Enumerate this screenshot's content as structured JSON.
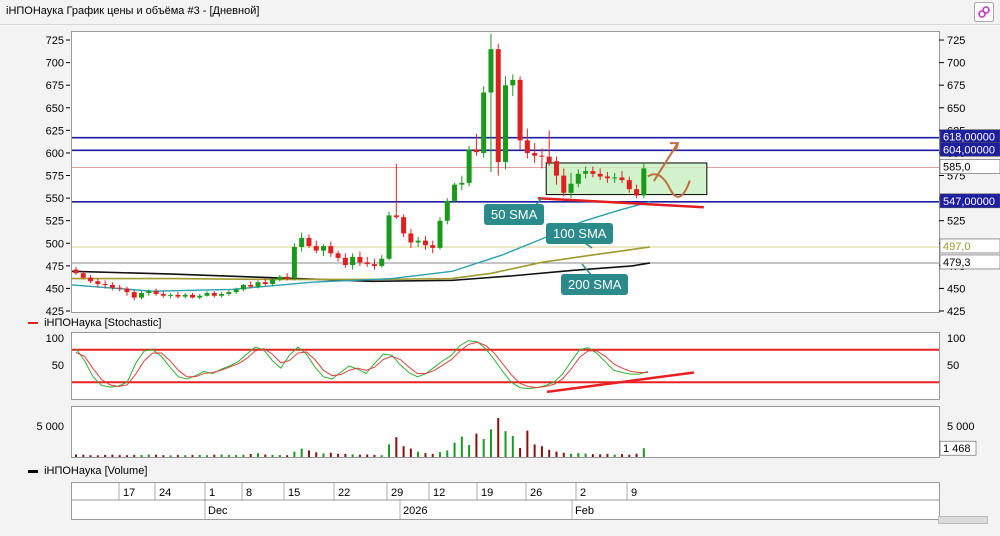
{
  "window": {
    "title": "iНПОНаука График цены и объёма #3 - [Дневной]"
  },
  "price_pane": {
    "y_ticks": [
      "725",
      "700",
      "675",
      "650",
      "625",
      "600",
      "575",
      "550",
      "525",
      "500",
      "475",
      "450",
      "425"
    ],
    "tags": {
      "level_618": "618,00000",
      "level_604": "604,00000",
      "last_price": "585,0",
      "level_547": "547,00000",
      "sma100_value": "497,0",
      "sma200_value": "479,3"
    },
    "callouts": {
      "sma50": "50 SMA",
      "sma100": "100 SMA",
      "sma200": "200 SMA"
    }
  },
  "stochastic_pane": {
    "legend": "iНПОНаука [Stochastic]",
    "y_ticks": [
      "100",
      "50"
    ]
  },
  "volume_pane": {
    "legend": "iНПОНаука [Volume]",
    "y_ticks": [
      "5 000"
    ],
    "last_value_tag": "1 468"
  },
  "x_axis": {
    "day_labels": [
      "17",
      "24",
      "1",
      "8",
      "15",
      "22",
      "29",
      "12",
      "19",
      "26",
      "2",
      "9"
    ],
    "month_labels": [
      "Dec",
      "2026",
      "Feb"
    ]
  },
  "colors": {
    "up_candle": "#1a9a1a",
    "down_candle": "#e02020",
    "horizontal_levels": "#1e1ea0",
    "sma50": "#2aa0b0",
    "sma100": "#a09a30",
    "sma200": "#111111",
    "callout_bg": "#2b8a8a",
    "stoch_bands": "#e82020"
  },
  "chart_data": [
    {
      "type": "candlestick",
      "title": "",
      "ylim": [
        425,
        735
      ],
      "horizontal_levels": [
        618,
        604,
        585,
        547,
        497,
        479.3
      ],
      "candles": [
        [
          472,
          475,
          466,
          468
        ],
        [
          468,
          470,
          461,
          463
        ],
        [
          463,
          466,
          457,
          459
        ],
        [
          459,
          462,
          452,
          456
        ],
        [
          456,
          460,
          451,
          455
        ],
        [
          455,
          458,
          449,
          452
        ],
        [
          452,
          455,
          448,
          451
        ],
        [
          451,
          453,
          443,
          447
        ],
        [
          447,
          449,
          438,
          441
        ],
        [
          441,
          448,
          439,
          446
        ],
        [
          446,
          450,
          443,
          448
        ],
        [
          448,
          451,
          443,
          445
        ],
        [
          445,
          448,
          441,
          443
        ],
        [
          443,
          446,
          440,
          444
        ],
        [
          444,
          447,
          440,
          442
        ],
        [
          442,
          446,
          440,
          444
        ],
        [
          444,
          446,
          440,
          441
        ],
        [
          441,
          445,
          439,
          443
        ],
        [
          443,
          448,
          442,
          446
        ],
        [
          446,
          448,
          441,
          443
        ],
        [
          443,
          447,
          441,
          445
        ],
        [
          445,
          449,
          443,
          447
        ],
        [
          447,
          452,
          445,
          450
        ],
        [
          450,
          456,
          448,
          455
        ],
        [
          455,
          459,
          451,
          453
        ],
        [
          453,
          460,
          451,
          458
        ],
        [
          458,
          462,
          454,
          456
        ],
        [
          456,
          462,
          454,
          461
        ],
        [
          461,
          466,
          459,
          464
        ],
        [
          464,
          468,
          460,
          462
        ],
        [
          463,
          501,
          460,
          497
        ],
        [
          497,
          513,
          492,
          507
        ],
        [
          507,
          511,
          496,
          498
        ],
        [
          498,
          504,
          490,
          493
        ],
        [
          493,
          500,
          487,
          498
        ],
        [
          498,
          503,
          486,
          490
        ],
        [
          490,
          493,
          481,
          485
        ],
        [
          485,
          490,
          474,
          477
        ],
        [
          477,
          490,
          472,
          486
        ],
        [
          486,
          492,
          476,
          480
        ],
        [
          480,
          486,
          475,
          478
        ],
        [
          478,
          484,
          472,
          476
        ],
        [
          476,
          488,
          474,
          484
        ],
        [
          484,
          536,
          482,
          532
        ],
        [
          532,
          589,
          528,
          530
        ],
        [
          530,
          533,
          508,
          512
        ],
        [
          512,
          517,
          496,
          502
        ],
        [
          502,
          508,
          497,
          504
        ],
        [
          504,
          509,
          494,
          499
        ],
        [
          499,
          504,
          490,
          496
        ],
        [
          496,
          530,
          494,
          526
        ],
        [
          526,
          551,
          522,
          548
        ],
        [
          548,
          568,
          546,
          566
        ],
        [
          566,
          576,
          560,
          568
        ],
        [
          568,
          609,
          564,
          605
        ],
        [
          605,
          622,
          598,
          602
        ],
        [
          601,
          675,
          596,
          668
        ],
        [
          668,
          733,
          580,
          716
        ],
        [
          716,
          722,
          576,
          591
        ],
        [
          591,
          686,
          583,
          676
        ],
        [
          676,
          688,
          664,
          682
        ],
        [
          682,
          686,
          605,
          615
        ],
        [
          615,
          628,
          595,
          601
        ],
        [
          601,
          612,
          590,
          598
        ],
        [
          598,
          606,
          584,
          597
        ],
        [
          597,
          626,
          587,
          590
        ],
        [
          592,
          597,
          566,
          576
        ],
        [
          576,
          584,
          553,
          557
        ],
        [
          557,
          579,
          551,
          567
        ],
        [
          567,
          583,
          563,
          578
        ],
        [
          578,
          586,
          573,
          581
        ],
        [
          581,
          586,
          574,
          578
        ],
        [
          578,
          584,
          571,
          575
        ],
        [
          575,
          580,
          568,
          573
        ],
        [
          573,
          579,
          568,
          574
        ],
        [
          574,
          581,
          568,
          571
        ],
        [
          571,
          575,
          557,
          561
        ],
        [
          561,
          566,
          551,
          554
        ],
        [
          554,
          590,
          551,
          584
        ]
      ],
      "annotations": [
        "50 SMA",
        "100 SMA",
        "200 SMA"
      ]
    },
    {
      "type": "line",
      "title": "",
      "ylim": [
        0,
        100
      ],
      "bands": [
        20,
        80
      ],
      "series": [
        {
          "values": [
            82,
            60,
            30,
            14,
            11,
            13,
            20,
            55,
            78,
            80,
            68,
            48,
            30,
            26,
            32,
            40,
            36,
            44,
            50,
            58,
            72,
            85,
            80,
            60,
            46,
            70,
            85,
            72,
            48,
            30,
            26,
            38,
            50,
            44,
            36,
            55,
            72,
            70,
            52,
            38,
            30,
            36,
            48,
            60,
            70,
            88,
            97,
            95,
            82,
            62,
            40,
            20,
            10,
            8,
            10,
            14,
            20,
            35,
            58,
            80,
            84,
            74,
            58,
            42,
            38,
            35,
            35,
            40
          ]
        },
        {
          "values": [
            75,
            68,
            45,
            25,
            15,
            12,
            15,
            35,
            60,
            74,
            74,
            60,
            42,
            30,
            30,
            36,
            38,
            42,
            48,
            54,
            64,
            78,
            82,
            72,
            56,
            60,
            74,
            76,
            62,
            42,
            32,
            34,
            42,
            46,
            42,
            48,
            62,
            68,
            62,
            48,
            36,
            36,
            42,
            52,
            62,
            78,
            90,
            94,
            88,
            74,
            54,
            34,
            18,
            12,
            10,
            12,
            16,
            26,
            44,
            66,
            78,
            78,
            68,
            54,
            46,
            40,
            38,
            38
          ]
        }
      ]
    },
    {
      "type": "bar",
      "title": "",
      "ylim": [
        0,
        8000
      ],
      "values": [
        420,
        380,
        300,
        280,
        350,
        400,
        320,
        300,
        360,
        340,
        420,
        380,
        300,
        280,
        320,
        300,
        340,
        360,
        300,
        380,
        420,
        350,
        330,
        380,
        500,
        640,
        420,
        360,
        320,
        300,
        900,
        1400,
        1100,
        780,
        600,
        700,
        520,
        500,
        440,
        380,
        420,
        360,
        300,
        2100,
        3300,
        1800,
        1400,
        900,
        640,
        520,
        800,
        1100,
        2400,
        3400,
        2000,
        3900,
        3000,
        4600,
        6500,
        4300,
        3500,
        1500,
        4400,
        2100,
        1800,
        1200,
        900,
        700,
        520,
        650,
        580,
        480,
        440,
        520,
        400,
        480,
        380,
        560,
        1468
      ]
    }
  ]
}
